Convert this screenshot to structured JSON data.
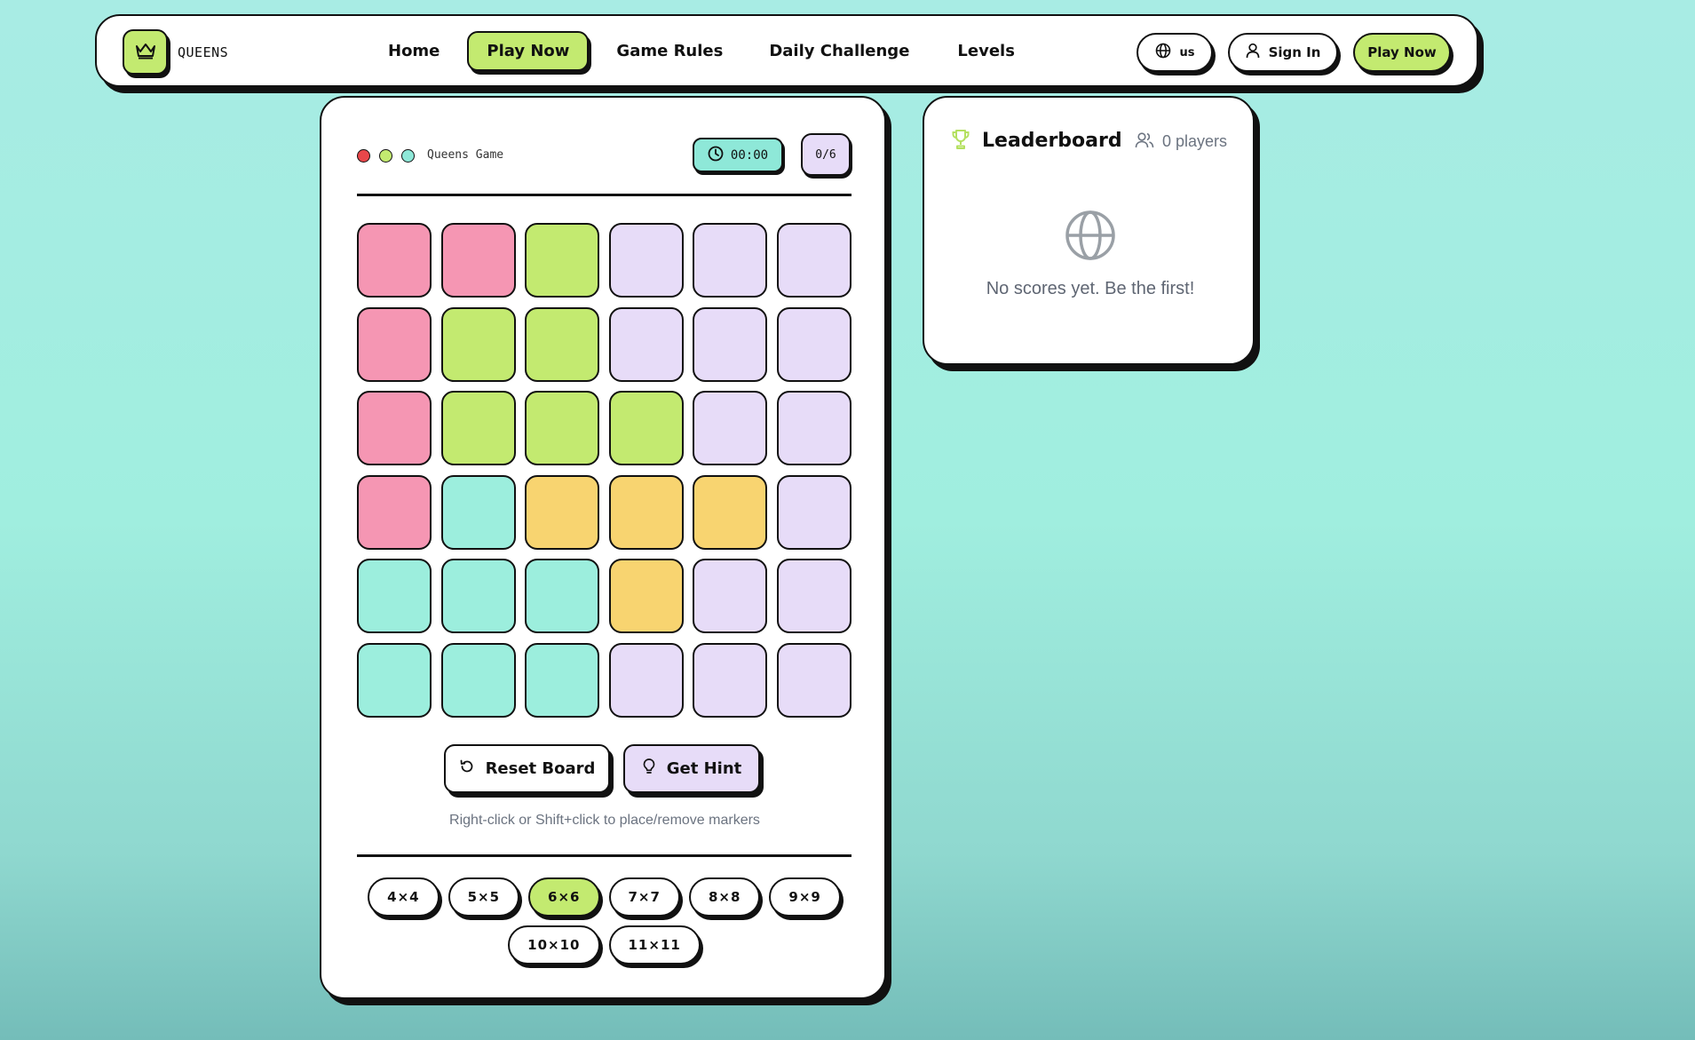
{
  "colors": {
    "pink": "#f596b3",
    "green": "#c3ea70",
    "lavender": "#e7dcf8",
    "teal": "#9ceedd",
    "yellow": "#f8d470",
    "accent": "#c3ea70"
  },
  "navbar": {
    "logo_icon": "crown-icon",
    "logo_text": "QUEENS",
    "links": [
      "Home",
      "Play Now",
      "Game Rules",
      "Daily Challenge",
      "Levels"
    ],
    "lang_label": "us",
    "signin_label": "Sign In",
    "playnow_label": "Play Now"
  },
  "game": {
    "label": "Queens Game",
    "timer": "00:00",
    "queens_count": "0/6",
    "board": [
      [
        "pink",
        "pink",
        "green",
        "lavender",
        "lavender",
        "lavender"
      ],
      [
        "pink",
        "green",
        "green",
        "lavender",
        "lavender",
        "lavender"
      ],
      [
        "pink",
        "green",
        "green",
        "green",
        "lavender",
        "lavender"
      ],
      [
        "pink",
        "teal",
        "yellow",
        "yellow",
        "yellow",
        "lavender"
      ],
      [
        "teal",
        "teal",
        "teal",
        "yellow",
        "lavender",
        "lavender"
      ],
      [
        "teal",
        "teal",
        "teal",
        "lavender",
        "lavender",
        "lavender"
      ]
    ],
    "reset_label": "Reset Board",
    "hint_label": "Get Hint",
    "instructions": "Right-click or Shift+click to place/remove markers",
    "sizes": [
      "4×4",
      "5×5",
      "6×6",
      "7×7",
      "8×8",
      "9×9",
      "10×10",
      "11×11"
    ],
    "selected_size": "6×6"
  },
  "leaderboard": {
    "title": "Leaderboard",
    "players": "0 players",
    "empty_message": "No scores yet. Be the first!"
  }
}
